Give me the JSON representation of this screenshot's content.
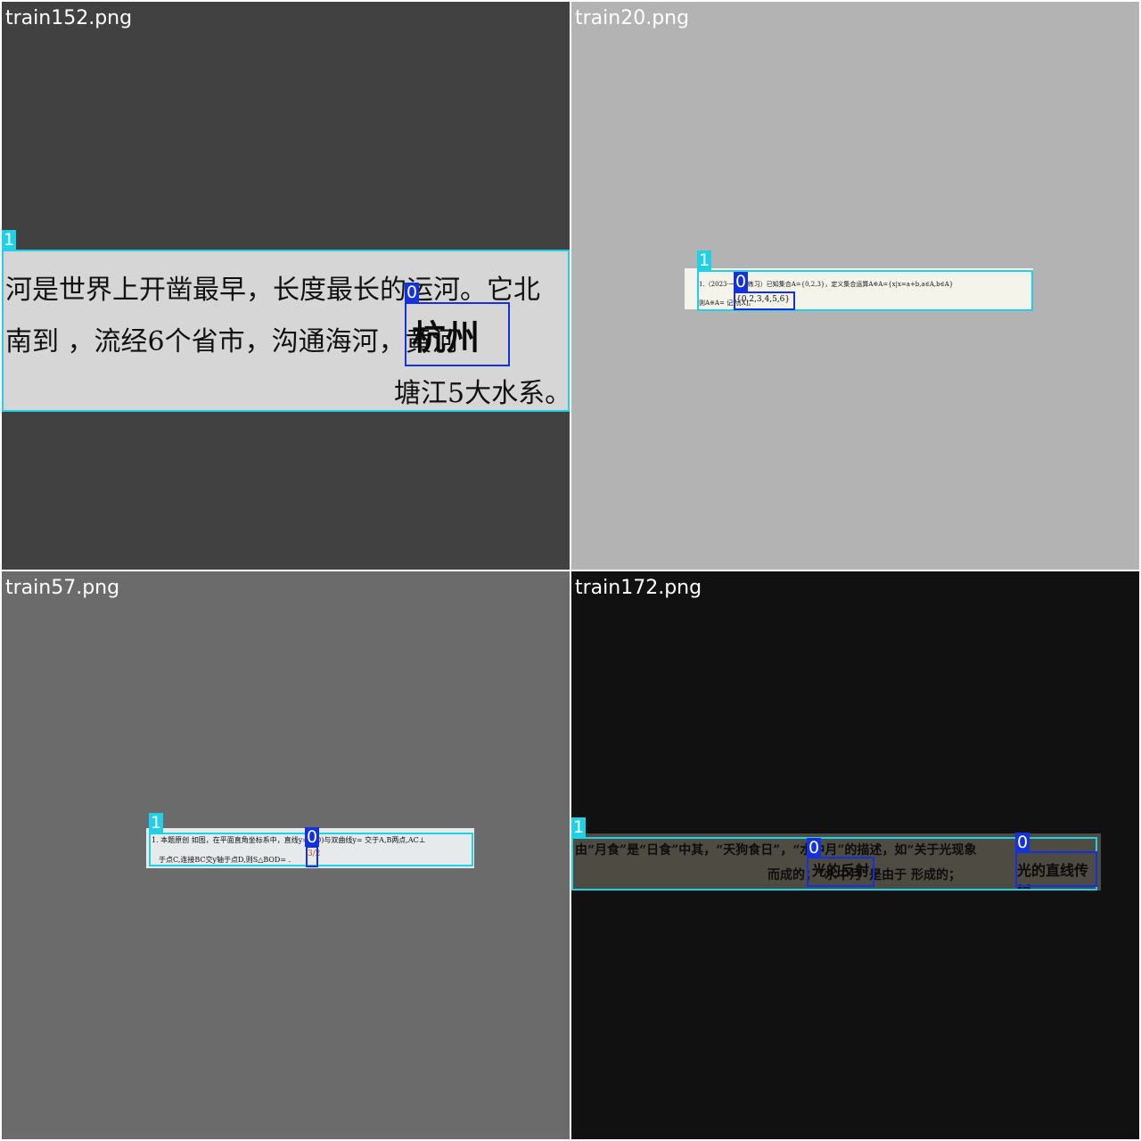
{
  "colors": {
    "class_1_box": "#1fd1e6",
    "class_0_box": "#1431e0",
    "title_text": "#ffffff"
  },
  "tiles": [
    {
      "title": "train152.png",
      "background": "#414141",
      "lines": [
        "河是世界上开凿最早，长度最长的运河。它北",
        "南到       ，流经6个省市，沟通海河，黄河",
        "塘江5大水系。"
      ],
      "handwriting": "杭州",
      "labels": [
        "1",
        "0"
      ]
    },
    {
      "title": "train20.png",
      "background": "#b3b3b3",
      "lines": [
        "1.（2023·一课时练习）已知集合A={0,2,3}，定义集合运算A※A={x|x=a+b,a∈A,b∈A}",
        "则A※A=                                    记为[X]。"
      ],
      "handwriting": "{0,2,3,4,5,6}",
      "labels": [
        "1",
        "0"
      ]
    },
    {
      "title": "train57.png",
      "background": "#6b6b6b",
      "lines": [
        "1. 本题原创 如图，在平面直角坐标系中，直线y=    ≠0)与双曲线y=    交于A,B两点,AC⊥",
        "于点C,连接BC交y轴于点D,则S△BOD=         ."
      ],
      "handwriting": "3/2",
      "labels": [
        "1",
        "0"
      ]
    },
    {
      "title": "train172.png",
      "background": "#111111",
      "lines": [
        "由“月食”是“日食”中其，“天狗食日”，“水中月”的描述，如“关于光现象",
        "而成的；“水中月”是由于               形成的；"
      ],
      "handwriting": [
        "光的反射",
        "光的直线传播"
      ],
      "labels": [
        "1",
        "0",
        "0"
      ]
    }
  ]
}
